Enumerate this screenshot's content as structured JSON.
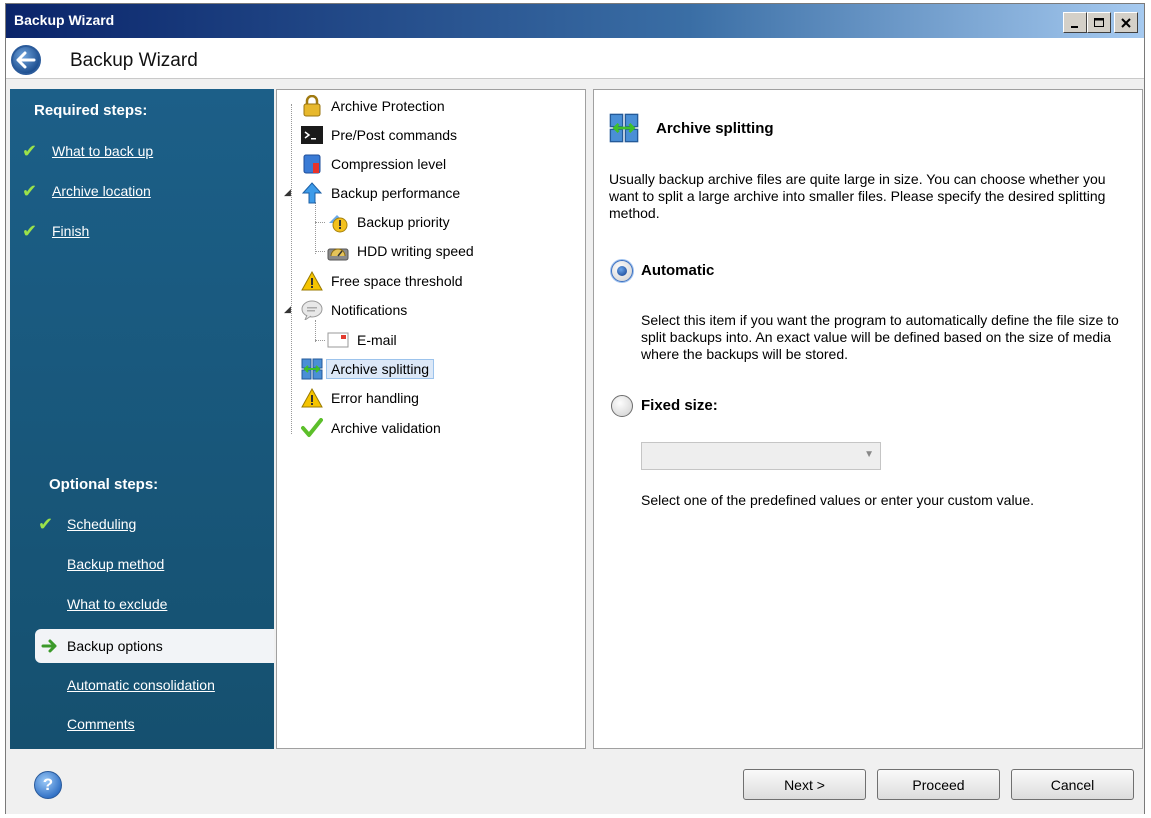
{
  "window": {
    "title": "Backup Wizard",
    "controls": [
      "minimize",
      "maximize",
      "close"
    ]
  },
  "header": {
    "title": "Backup Wizard"
  },
  "left_nav": {
    "required_heading": "Required steps:",
    "required_items": [
      {
        "label": "What to back up",
        "checked": true
      },
      {
        "label": "Archive location",
        "checked": true
      },
      {
        "label": "Finish",
        "checked": true
      }
    ],
    "optional_heading": "Optional steps:",
    "optional_items": [
      {
        "label": "Scheduling",
        "checked": true
      },
      {
        "label": "Backup method",
        "checked": false
      },
      {
        "label": "What to exclude",
        "checked": false
      },
      {
        "label": "Backup options",
        "checked": false,
        "active": true
      },
      {
        "label": "Automatic consolidation",
        "checked": false
      },
      {
        "label": "Comments",
        "checked": false
      }
    ]
  },
  "tree": {
    "items": [
      {
        "label": "Archive Protection",
        "icon": "lock-icon"
      },
      {
        "label": "Pre/Post commands",
        "icon": "console-icon"
      },
      {
        "label": "Compression level",
        "icon": "compression-icon"
      },
      {
        "label": "Backup performance",
        "icon": "up-arrow-icon"
      },
      {
        "label": "Backup priority",
        "icon": "priority-icon"
      },
      {
        "label": "HDD writing speed",
        "icon": "hdd-icon"
      },
      {
        "label": "Free space threshold",
        "icon": "warning-icon"
      },
      {
        "label": "Notifications",
        "icon": "speech-bubble-icon"
      },
      {
        "label": "E-mail",
        "icon": "email-icon"
      },
      {
        "label": "Archive splitting",
        "icon": "split-icon"
      },
      {
        "label": "Error handling",
        "icon": "warning-icon"
      },
      {
        "label": "Archive validation",
        "icon": "checkmark-icon"
      }
    ],
    "selected": "Archive splitting"
  },
  "panel": {
    "title": "Archive splitting",
    "description": "Usually backup archive files are quite large in size. You can choose whether you want to split a large archive into smaller files. Please specify the desired splitting method.",
    "automatic_label": "Automatic",
    "automatic_desc": "Select this item if you want the program to automatically define the file size to split backups into. An exact value will be defined based on the size of media where the backups will be stored.",
    "fixed_label": "Fixed size:",
    "fixed_value": "",
    "fixed_desc": "Select one of the predefined values or enter your custom value.",
    "selected_option": "Automatic"
  },
  "footer": {
    "next_label": "Next >",
    "proceed_label": "Proceed",
    "cancel_label": "Cancel"
  },
  "colors": {
    "nav_bg": "#1c5f88",
    "check": "#9be24a",
    "title_bar": "#0a246a"
  }
}
